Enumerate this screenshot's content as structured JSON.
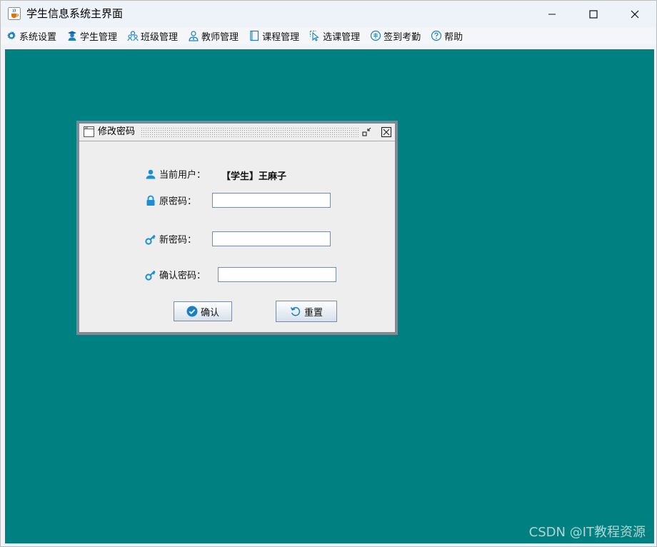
{
  "window": {
    "title": "学生信息系统主界面",
    "icons": {
      "app": "java-cup-icon",
      "minimize": "minimize-icon",
      "maximize": "maximize-icon",
      "close": "close-icon"
    }
  },
  "menubar": {
    "items": [
      {
        "label": "系统设置",
        "icon": "gear-icon"
      },
      {
        "label": "学生管理",
        "icon": "student-icon"
      },
      {
        "label": "班级管理",
        "icon": "class-icon"
      },
      {
        "label": "教师管理",
        "icon": "teacher-icon"
      },
      {
        "label": "课程管理",
        "icon": "course-icon"
      },
      {
        "label": "选课管理",
        "icon": "cursor-select-icon"
      },
      {
        "label": "签到考勤",
        "icon": "attendance-icon"
      },
      {
        "label": "帮助",
        "icon": "help-icon"
      }
    ]
  },
  "dialog": {
    "title": "修改密码",
    "current_user_label": "当前用户：",
    "current_user_value": "【学生】王麻子",
    "old_password_label": "原密码：",
    "new_password_label": "新密码：",
    "confirm_password_label": "确认密码：",
    "old_password_value": "",
    "new_password_value": "",
    "confirm_password_value": "",
    "confirm_button": "确认",
    "reset_button": "重置"
  },
  "watermark": "CSDN @IT教程资源",
  "colors": {
    "desktop": "#008080",
    "accent_icon": "#1a8fd6"
  }
}
